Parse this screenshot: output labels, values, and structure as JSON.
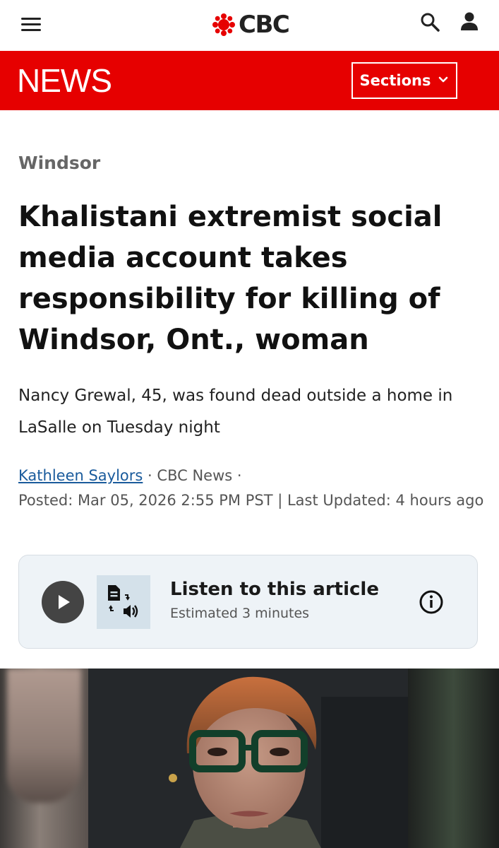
{
  "header": {
    "logo_text": "CBC",
    "icons": {
      "menu": "hamburger-menu-icon",
      "logo": "cbc-gem-icon",
      "search": "search-icon",
      "account": "user-icon"
    }
  },
  "newsbar": {
    "label": "NEWS",
    "sections_label": "Sections",
    "sections_icon": "chevron-down-icon"
  },
  "article": {
    "region": "Windsor",
    "headline": "Khalistani extremist social media account takes responsibility for killing of Windsor, Ont., woman",
    "deck": "Nancy Grewal, 45, was found dead outside a home in LaSalle on Tuesday night",
    "byline": {
      "author": "Kathleen Saylors",
      "separator": "·",
      "source": "CBC News",
      "posted": "Posted: Mar 05, 2026 2:55 PM PST | Last Updated: 4 hours ago"
    }
  },
  "listen": {
    "title": "Listen to this article",
    "estimate": "Estimated 3 minutes",
    "icons": {
      "play": "play-icon",
      "tts": "text-to-speech-icon",
      "info": "info-icon"
    }
  },
  "colors": {
    "brand_red": "#e60000",
    "link_blue": "#1a5b9c",
    "listen_bg": "#eef3f7"
  }
}
